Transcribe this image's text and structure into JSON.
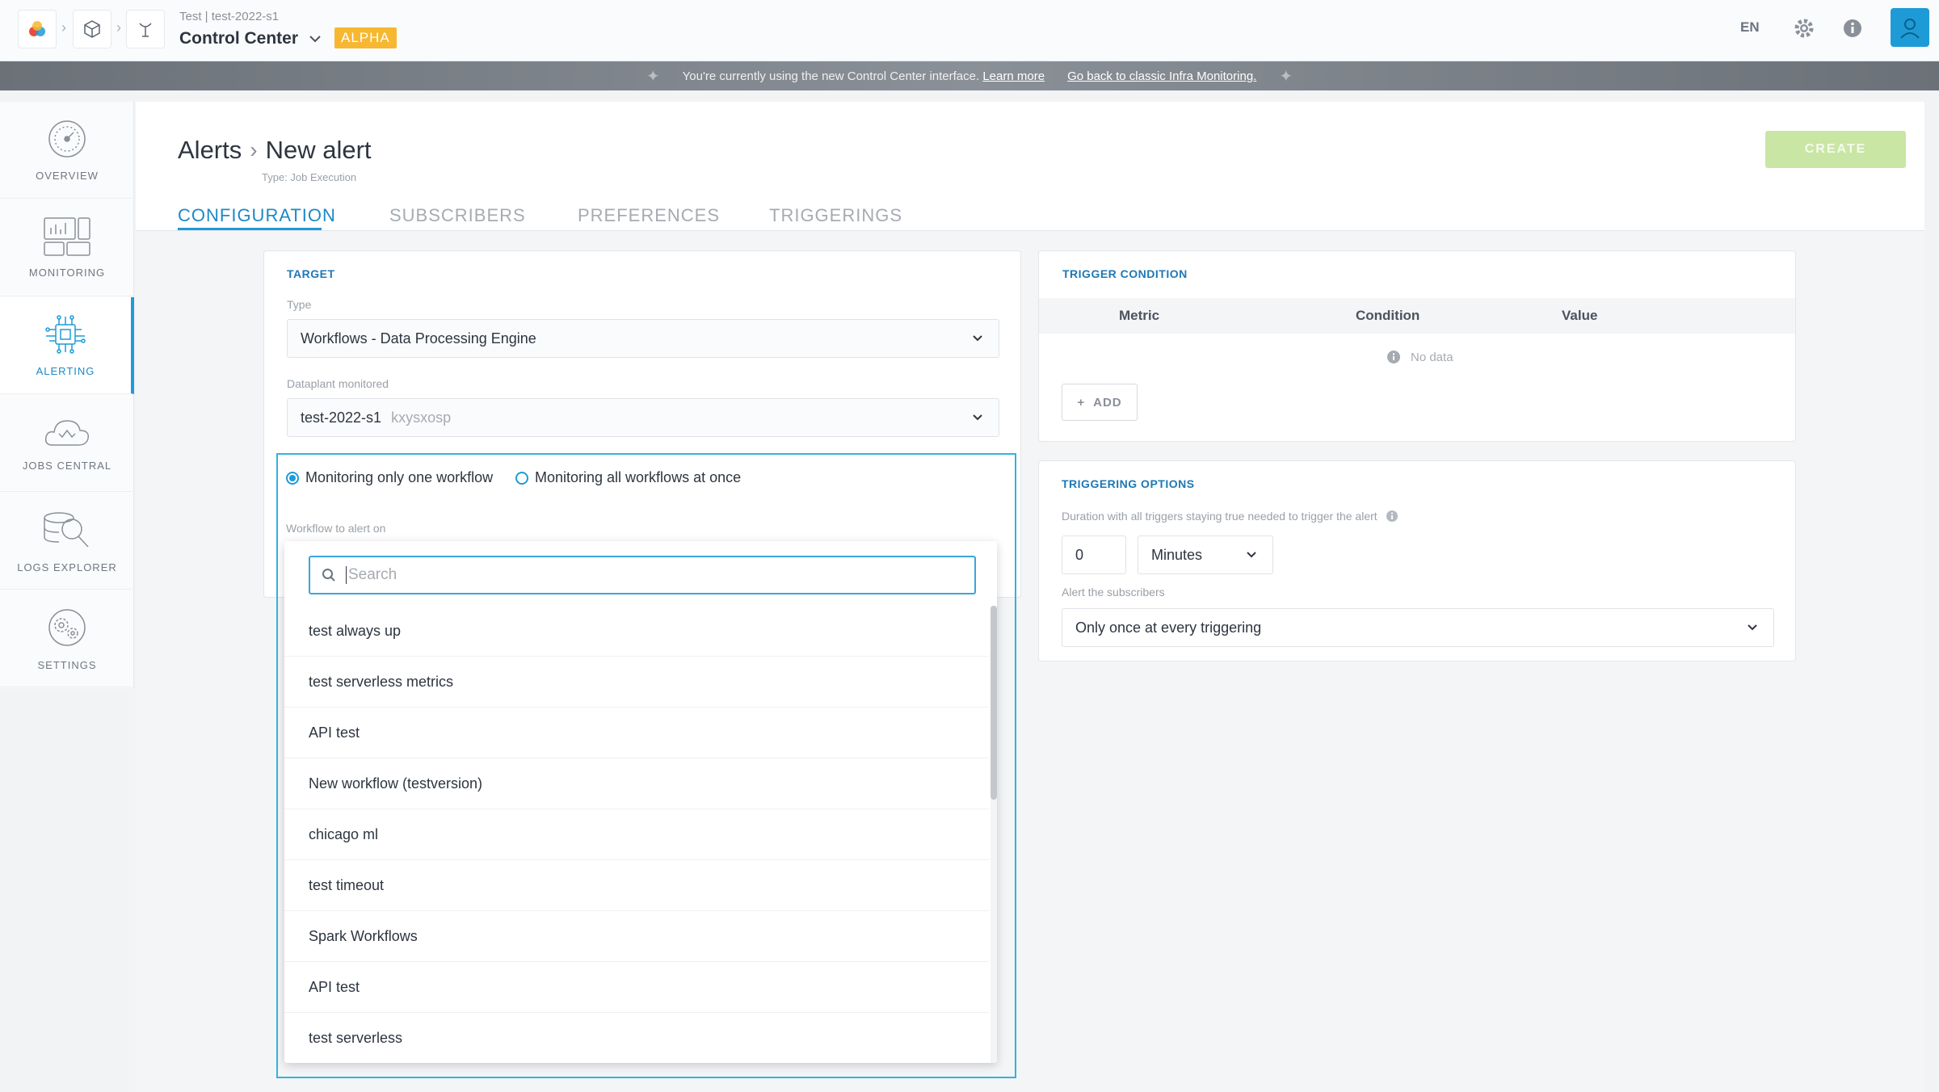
{
  "topbar": {
    "project_line": "Test | test-2022-s1",
    "app_name": "Control Center",
    "badge": "ALPHA",
    "language": "EN"
  },
  "banner": {
    "message": "You're currently using the new Control Center interface.",
    "learn_more": "Learn more",
    "go_back": "Go back to classic Infra Monitoring."
  },
  "sidebar": {
    "items": [
      {
        "label": "OVERVIEW",
        "icon": "gauge-icon"
      },
      {
        "label": "MONITORING",
        "icon": "monitor-icon"
      },
      {
        "label": "ALERTING",
        "icon": "chip-icon"
      },
      {
        "label": "JOBS CENTRAL",
        "icon": "cloud-icon"
      },
      {
        "label": "LOGS EXPLORER",
        "icon": "magnify-icon"
      },
      {
        "label": "SETTINGS",
        "icon": "gear-icon"
      }
    ],
    "active": "ALERTING"
  },
  "header": {
    "breadcrumb_parent": "Alerts",
    "breadcrumb_current": "New alert",
    "subtitle": "Type: Job Execution",
    "create_label": "CREATE"
  },
  "tabs": [
    "CONFIGURATION",
    "SUBSCRIBERS",
    "PREFERENCES",
    "TRIGGERINGS"
  ],
  "target": {
    "title": "TARGET",
    "type_label": "Type",
    "type_value": "Workflows - Data Processing Engine",
    "dataplant_label": "Dataplant monitored",
    "dataplant_value": "test-2022-s1",
    "dataplant_id": "kxysxosp",
    "radio_one": "Monitoring only one workflow",
    "radio_all": "Monitoring all workflows at once",
    "workflow_label": "Workflow to alert on",
    "search_placeholder": "Search",
    "options": [
      "test always up",
      "test serverless metrics",
      "API test",
      "New workflow (testversion)",
      "chicago ml",
      "test timeout",
      "Spark Workflows",
      "API test",
      "test serverless"
    ]
  },
  "trigger_condition": {
    "title": "TRIGGER CONDITION",
    "columns": [
      "Metric",
      "Condition",
      "Value"
    ],
    "empty": "No data",
    "add_label": "ADD"
  },
  "triggering_options": {
    "title": "TRIGGERING OPTIONS",
    "duration_label": "Duration with all triggers staying true needed to trigger the alert",
    "duration_value": "0",
    "duration_unit": "Minutes",
    "alert_label": "Alert the subscribers",
    "alert_value": "Only once at every triggering"
  },
  "colors": {
    "accent": "#1e9bd7",
    "create_disabled": "#c9e6a4",
    "badge": "#f7b731"
  }
}
